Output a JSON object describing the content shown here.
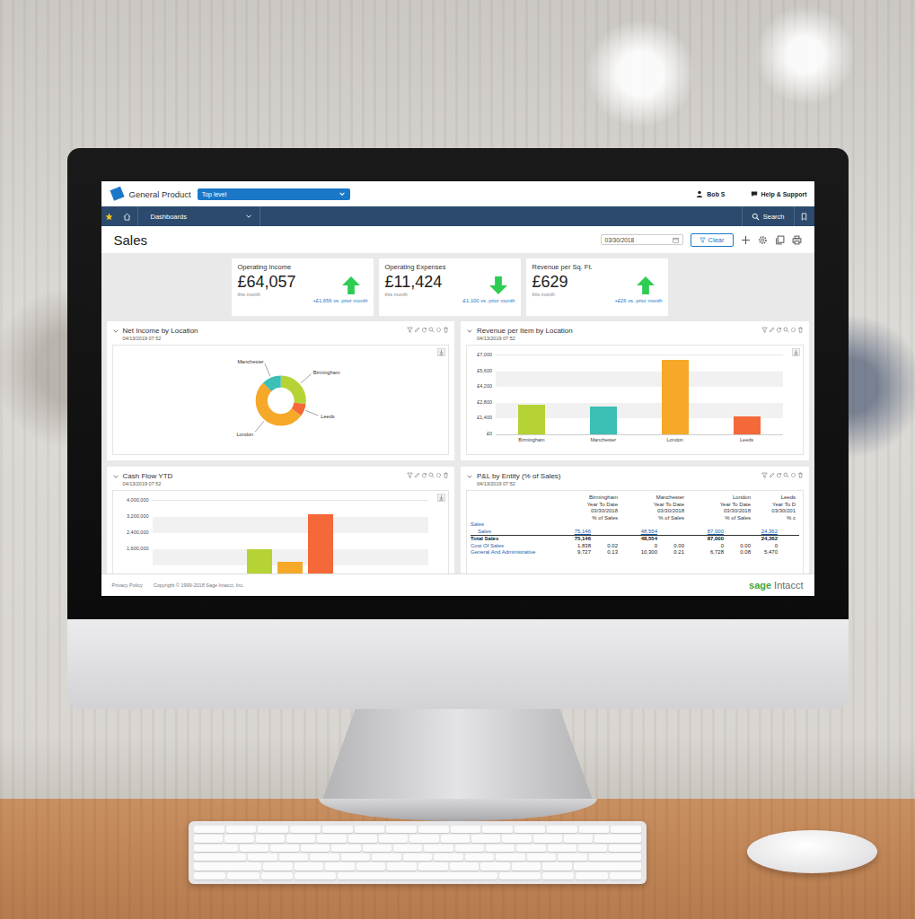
{
  "app": {
    "product": "General Product",
    "entity": "Top level",
    "user": "Bob S",
    "help": "Help & Support"
  },
  "nav": {
    "menu": "Dashboards",
    "search": "Search"
  },
  "page": {
    "title": "Sales",
    "date": "03/30/2018",
    "clear": "Clear"
  },
  "kpis": [
    {
      "title": "Operating Income",
      "value": "£64,057",
      "period": "this month",
      "delta": "+£1,656 vs. prior month",
      "trend": "up"
    },
    {
      "title": "Operating Expenses",
      "value": "£11,424",
      "period": "this month",
      "delta": "-£1,100 vs. prior month",
      "trend": "down"
    },
    {
      "title": "Revenue per Sq. Ft.",
      "value": "£629",
      "period": "this month",
      "delta": "+£26 vs. prior month",
      "trend": "up"
    }
  ],
  "net_income": {
    "title": "Net Income by Location",
    "timestamp": "04/13/2019 07:52",
    "segments": [
      {
        "label": "Birmingham",
        "value": 27,
        "color": "#b5d334"
      },
      {
        "label": "Leeds",
        "value": 8,
        "color": "#f4683a"
      },
      {
        "label": "London",
        "value": 52,
        "color": "#f6a829"
      },
      {
        "label": "Manchester",
        "value": 13,
        "color": "#3cbfb4"
      }
    ]
  },
  "revenue": {
    "title": "Revenue per Item by Location",
    "timestamp": "04/13/2019 07:52",
    "ticks": [
      "£7,000",
      "£5,600",
      "£4,200",
      "£2,800",
      "£1,400",
      "£0"
    ],
    "axis_max": 7000,
    "bars": [
      {
        "label": "Birmingham",
        "value": 2620,
        "color": "#b5d334"
      },
      {
        "label": "Manchester",
        "value": 2470,
        "color": "#3cbfb4"
      },
      {
        "label": "London",
        "value": 6600,
        "color": "#f6a829"
      },
      {
        "label": "Leeds",
        "value": 1590,
        "color": "#f4683a"
      }
    ]
  },
  "cash_flow": {
    "title": "Cash Flow YTD",
    "timestamp": "04/13/2019 07:52",
    "ticks": [
      "4,000,000",
      "3,200,000",
      "2,400,000",
      "1,600,000"
    ],
    "axis_max": 4000000,
    "bars": [
      {
        "value": 1580000,
        "color": "#b5d334"
      },
      {
        "value": 980000,
        "color": "#f6a829"
      },
      {
        "value": 3350000,
        "color": "#f4683a"
      }
    ]
  },
  "pnl": {
    "title": "P&L by Entity (% of Sales)",
    "timestamp": "04/13/2019 07:52",
    "entities": [
      {
        "name": "Birmingham",
        "period": "Year To Date",
        "date": "03/30/2018",
        "pct_label": "% of Sales"
      },
      {
        "name": "Manchester",
        "period": "Year To Date",
        "date": "03/30/2018",
        "pct_label": "% of Sales"
      },
      {
        "name": "London",
        "period": "Year To Date",
        "date": "03/30/2018",
        "pct_label": "% of Sales"
      },
      {
        "name": "Leeds",
        "period": "Year To D",
        "date": "03/30/201",
        "pct_label": "% c"
      }
    ],
    "rows": [
      {
        "label": "Sales",
        "kind": "section",
        "cells": []
      },
      {
        "label": "Sales",
        "kind": "detail",
        "cells": [
          "75,146",
          "",
          "48,554",
          "",
          "87,000",
          "",
          "24,362",
          ""
        ]
      },
      {
        "label": "Total Sales",
        "kind": "total",
        "cells": [
          "75,146",
          "",
          "48,554",
          "",
          "87,000",
          "",
          "24,362",
          ""
        ]
      },
      {
        "label": "Cost Of Sales",
        "kind": "account",
        "cells": [
          "1,838",
          "0.02",
          "0",
          "0.00",
          "0",
          "0.00",
          "0",
          ""
        ]
      },
      {
        "label": "General And Administrative",
        "kind": "account",
        "cells": [
          "9,727",
          "0.13",
          "10,300",
          "0.21",
          "6,728",
          "0.08",
          "5,470",
          ""
        ]
      }
    ]
  },
  "footer": {
    "privacy": "Privacy Policy",
    "copyright": "Copyright © 1999-2018 Sage Intacct, Inc.",
    "brand": "sage",
    "brand_product": "Intacct"
  }
}
